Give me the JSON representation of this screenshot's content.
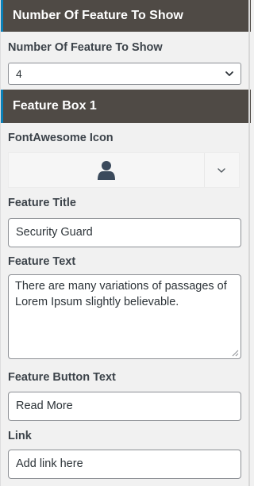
{
  "number_section": {
    "header": "Number Of Feature To Show",
    "field_label": "Number Of Feature To Show",
    "selected_value": "4"
  },
  "feature_box": {
    "header": "Feature Box 1",
    "icon": {
      "label": "FontAwesome Icon",
      "selected_icon": "user-icon"
    },
    "title": {
      "label": "Feature Title",
      "value": "Security Guard"
    },
    "text": {
      "label": "Feature Text",
      "value": "There are many variations of passages of Lorem Ipsum slightly believable."
    },
    "button_text": {
      "label": "Feature Button Text",
      "value": "Read More"
    },
    "link": {
      "label": "Link",
      "placeholder": "Add link here"
    }
  },
  "colors": {
    "header_bg": "#4f4a45",
    "header_accent": "#0a7fb6",
    "panel_bg": "#f1f1f1"
  }
}
